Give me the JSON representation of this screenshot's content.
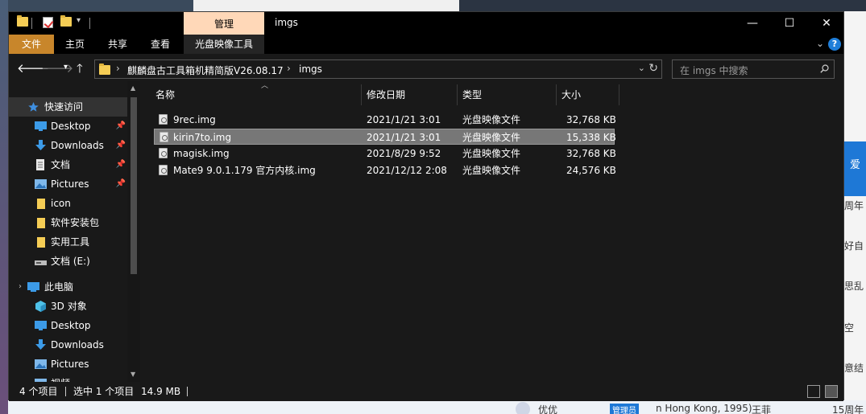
{
  "window": {
    "title": "imgs",
    "context_tab_group": "管理",
    "controls": {
      "minimize": "—",
      "maximize": "☐",
      "close": "✕"
    }
  },
  "ribbon": {
    "tabs": [
      "文件",
      "主页",
      "共享",
      "查看",
      "光盘映像工具"
    ],
    "help": "?"
  },
  "address": {
    "crumbs": [
      "麒麟盘古工具箱机精简版V26.08.17",
      "imgs"
    ]
  },
  "search": {
    "placeholder": "在 imgs 中搜索"
  },
  "sidebar": {
    "items": [
      {
        "label": "快速访问",
        "icon": "star-icon",
        "pinned": false
      },
      {
        "label": "Desktop",
        "icon": "desktop-icon",
        "pinned": true
      },
      {
        "label": "Downloads",
        "icon": "download-icon",
        "pinned": true
      },
      {
        "label": "文档",
        "icon": "document-icon",
        "pinned": true
      },
      {
        "label": "Pictures",
        "icon": "pictures-icon",
        "pinned": true
      },
      {
        "label": "icon",
        "icon": "folder-icon",
        "pinned": false
      },
      {
        "label": "软件安装包",
        "icon": "folder-icon",
        "pinned": false
      },
      {
        "label": "实用工具",
        "icon": "folder-icon",
        "pinned": false
      },
      {
        "label": "文档 (E:)",
        "icon": "drive-icon",
        "pinned": false
      },
      {
        "label": "此电脑",
        "icon": "computer-icon",
        "pinned": false
      },
      {
        "label": "3D 对象",
        "icon": "3d-objects-icon",
        "pinned": false
      },
      {
        "label": "Desktop",
        "icon": "desktop-icon",
        "pinned": false
      },
      {
        "label": "Downloads",
        "icon": "download-icon",
        "pinned": false
      },
      {
        "label": "Pictures",
        "icon": "pictures-icon",
        "pinned": false
      },
      {
        "label": "视频",
        "icon": "video-icon",
        "pinned": false
      }
    ]
  },
  "files": {
    "columns": [
      "名称",
      "修改日期",
      "类型",
      "大小"
    ],
    "rows": [
      {
        "name": "9rec.img",
        "date": "2021/1/21 3:01",
        "type": "光盘映像文件",
        "size": "32,768 KB",
        "selected": false
      },
      {
        "name": "kirin7to.img",
        "date": "2021/1/21 3:01",
        "type": "光盘映像文件",
        "size": "15,338 KB",
        "selected": true
      },
      {
        "name": "magisk.img",
        "date": "2021/8/29 9:52",
        "type": "光盘映像文件",
        "size": "32,768 KB",
        "selected": false
      },
      {
        "name": "Mate9 9.0.1.179 官方内核.img",
        "date": "2021/12/12 2:08",
        "type": "光盘映像文件",
        "size": "24,576 KB",
        "selected": false
      }
    ]
  },
  "status": {
    "item_count": "4 个项目",
    "selection": "选中 1 个项目",
    "size": "14.9 MB"
  },
  "background": {
    "right_labels": [
      "爱",
      "周年",
      "好自",
      "思乱",
      "空",
      "意结"
    ],
    "bottom_labels": [
      "优优",
      "管理员",
      "n Hong Kong, 1995)",
      "王菲",
      "15周年"
    ]
  },
  "colors": {
    "file_tab": "#c8862b",
    "context_tab": "#ffd8b8",
    "selection": "#777777",
    "help": "#1f7ed9"
  }
}
